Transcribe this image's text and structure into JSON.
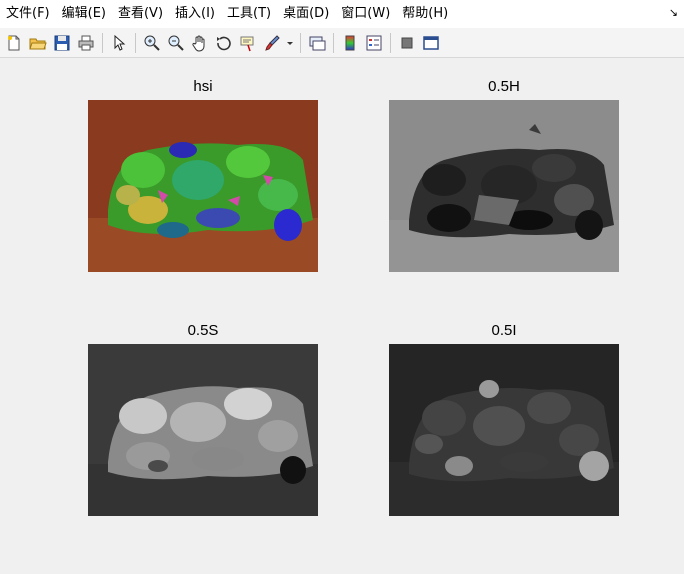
{
  "menubar": {
    "items": [
      "文件(F)",
      "编辑(E)",
      "查看(V)",
      "插入(I)",
      "工具(T)",
      "桌面(D)",
      "窗口(W)",
      "帮助(H)"
    ],
    "dock_glyph": "↘"
  },
  "toolbar": {
    "icons": [
      "new-figure-icon",
      "open-file-icon",
      "save-icon",
      "print-icon",
      "pointer-icon",
      "zoom-in-icon",
      "zoom-out-icon",
      "pan-icon",
      "rotate-3d-icon",
      "data-cursor-icon",
      "brush-icon",
      "link-plot-icon",
      "colorbar-icon",
      "legend-icon",
      "hide-plot-tools-icon",
      "show-plot-tools-icon"
    ]
  },
  "plots": [
    {
      "title": "hsi"
    },
    {
      "title": "0.5H"
    },
    {
      "title": "0.5S"
    },
    {
      "title": "0.5I"
    }
  ]
}
